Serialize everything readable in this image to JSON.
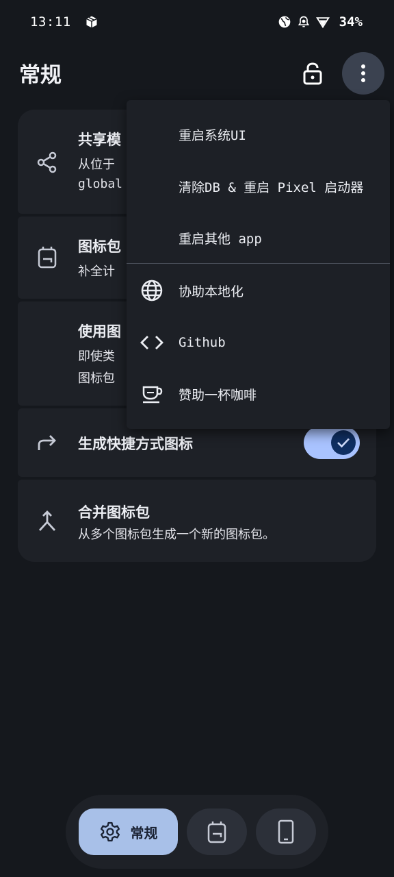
{
  "status_bar": {
    "time": "13:11",
    "battery": "34%"
  },
  "app_bar": {
    "title": "常规"
  },
  "cards": [
    {
      "title": "共享模",
      "subtitle_line1": "从位于",
      "subtitle_line2": "global"
    },
    {
      "title": "图标包",
      "subtitle": "补全计"
    },
    {
      "title": "使用图",
      "subtitle_line1": "即使类",
      "subtitle_line2": "图标包"
    },
    {
      "title": "生成快捷方式图标",
      "toggle_on": true
    },
    {
      "title": "合并图标包",
      "subtitle": "从多个图标包生成一个新的图标包。"
    }
  ],
  "menu": {
    "items": [
      {
        "label": "重启系统UI"
      },
      {
        "label": "清除DB & 重启 Pixel 启动器"
      },
      {
        "label": "重启其他 app"
      },
      {
        "label": "协助本地化",
        "icon": "globe-icon"
      },
      {
        "label": "Github",
        "icon": "code-icon"
      },
      {
        "label": "赞助一杯咖啡",
        "icon": "coffee-cup-icon"
      }
    ]
  },
  "nav": {
    "items": [
      {
        "label": "常规",
        "selected": true
      },
      {
        "icon": "icon-pack-icon"
      },
      {
        "icon": "phone-icon"
      }
    ]
  },
  "colors": {
    "background": "#15181d",
    "card": "#1e2127",
    "accent": "#a9c3ff",
    "selected_nav": "#a8c0e8"
  }
}
